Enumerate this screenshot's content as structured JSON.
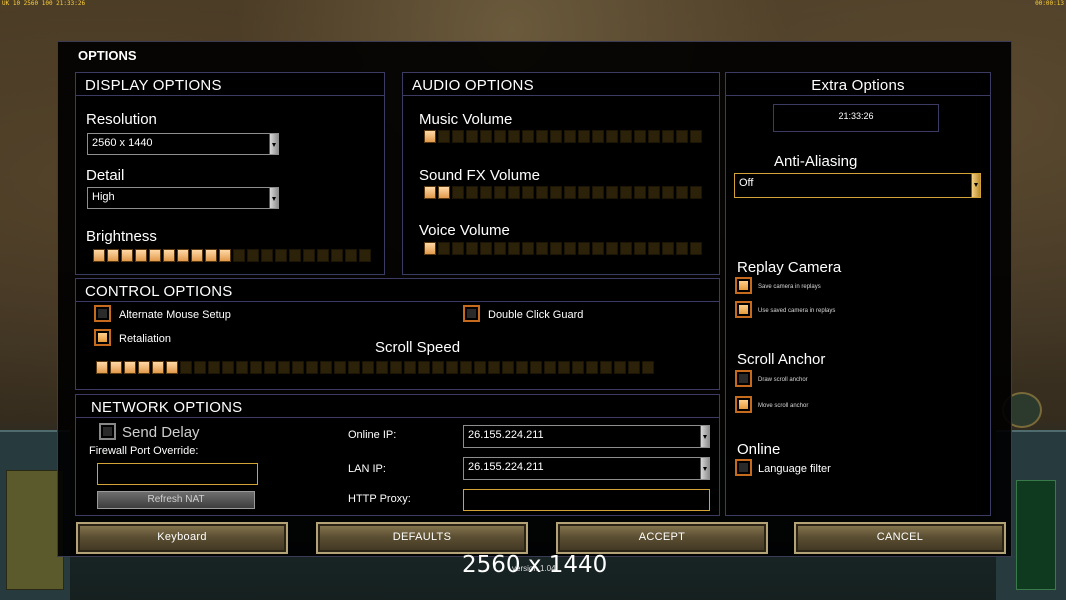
{
  "hud": {
    "top_left_status": "UK 10 2560 100 21:33:26",
    "top_right_time": "00:00:13"
  },
  "window": {
    "title": "OPTIONS"
  },
  "display": {
    "header": "DISPLAY OPTIONS",
    "resolution_label": "Resolution",
    "resolution_value": "2560 x 1440",
    "detail_label": "Detail",
    "detail_value": "High",
    "brightness_label": "Brightness",
    "brightness_level": 10,
    "brightness_max": 20
  },
  "audio": {
    "header": "AUDIO OPTIONS",
    "music_label": "Music Volume",
    "music_level": 1,
    "sfx_label": "Sound FX Volume",
    "sfx_level": 2,
    "voice_label": "Voice Volume",
    "voice_level": 1,
    "max": 20
  },
  "extra": {
    "header": "Extra Options",
    "clock": "21:33:26",
    "aa_label": "Anti-Aliasing",
    "aa_value": "Off",
    "replay_label": "Replay Camera",
    "replay_save": "Save camera in replays",
    "replay_use": "Use saved camera in replays",
    "scroll_anchor_label": "Scroll Anchor",
    "draw_anchor": "Draw scroll anchor",
    "move_anchor": "Move scroll anchor",
    "online_label": "Online",
    "language_filter": "Language filter"
  },
  "control": {
    "header": "CONTROL OPTIONS",
    "alt_mouse": "Alternate Mouse Setup",
    "double_click": "Double Click Guard",
    "retaliation": "Retaliation",
    "scroll_speed_label": "Scroll Speed",
    "scroll_speed_level": 6,
    "scroll_speed_max": 40
  },
  "network": {
    "header": "NETWORK OPTIONS",
    "send_delay": "Send Delay",
    "firewall_label": "Firewall Port Override:",
    "refresh_nat": "Refresh NAT",
    "online_ip_label": "Online IP:",
    "online_ip_value": "26.155.224.211",
    "lan_ip_label": "LAN IP:",
    "lan_ip_value": "26.155.224.211",
    "http_proxy_label": "HTTP Proxy:"
  },
  "buttons": {
    "keyboard": "Keyboard",
    "defaults": "DEFAULTS",
    "accept": "ACCEPT",
    "cancel": "CANCEL"
  },
  "overlay": {
    "resolution_text": "2560 x 1440",
    "version": "version 1.04"
  }
}
